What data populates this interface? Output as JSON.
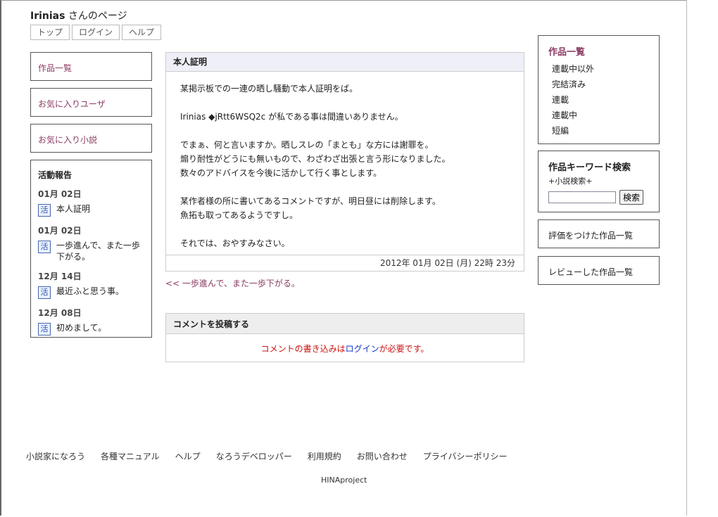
{
  "header": {
    "username": "Irinias",
    "title_suffix": " さんのページ",
    "nav": [
      "トップ",
      "ログイン",
      "ヘルプ"
    ]
  },
  "left": {
    "links": [
      "作品一覧",
      "お気に入りユーザ",
      "お気に入り小説"
    ],
    "report": {
      "title": "活動報告",
      "icon_label": "活",
      "items": [
        {
          "date": "01月 02日",
          "text": "本人証明"
        },
        {
          "date": "01月 02日",
          "text": "一歩進んで、また一歩下がる。"
        },
        {
          "date": "12月 14日",
          "text": "最近ふと思う事。"
        },
        {
          "date": "12月 08日",
          "text": "初めまして。"
        }
      ]
    }
  },
  "post": {
    "title": "本人証明",
    "lines": [
      "某掲示板での一連の晒し騒動で本人証明をば。",
      "",
      "Irinias ◆jRtt6WSQ2c が私である事は間違いありません。",
      "",
      "でまぁ、何と言いますか。晒しスレの「まとも」な方には謝罪を。",
      "煽り耐性がどうにも無いもので、わざわざ出張と言う形になりました。",
      "数々のアドバイスを今後に活かして行く事とします。",
      "",
      "某作者様の所に書いてあるコメントですが、明日昼には削除します。",
      "魚拓も取ってあるようですし。",
      "",
      "それでは、おやすみなさい。"
    ],
    "timestamp": "2012年 01月 02日 (月) 22時 23分",
    "prev_link": "<< 一歩進んで、また一歩下がる。"
  },
  "comment": {
    "title": "コメントを投稿する",
    "msg_pre": "コメントの書き込みは",
    "login_link": "ログイン",
    "msg_post": "が必要です。"
  },
  "right": {
    "works_title": "作品一覧",
    "works_items": [
      "連載中以外",
      "完結済み",
      "連載",
      "連載中",
      "短編"
    ],
    "search_title": "作品キーワード検索",
    "search_sub": "+小説検索+",
    "search_input_value": "",
    "search_button": "検索",
    "rated_link": "評価をつけた作品一覧",
    "review_link": "レビューした作品一覧"
  },
  "footer": {
    "links": [
      "小説家になろう",
      "各種マニュアル",
      "ヘルプ",
      "なろうデベロッパー",
      "利用規約",
      "お問い合わせ",
      "プライバシーポリシー"
    ],
    "copyright": "HINAproject"
  }
}
